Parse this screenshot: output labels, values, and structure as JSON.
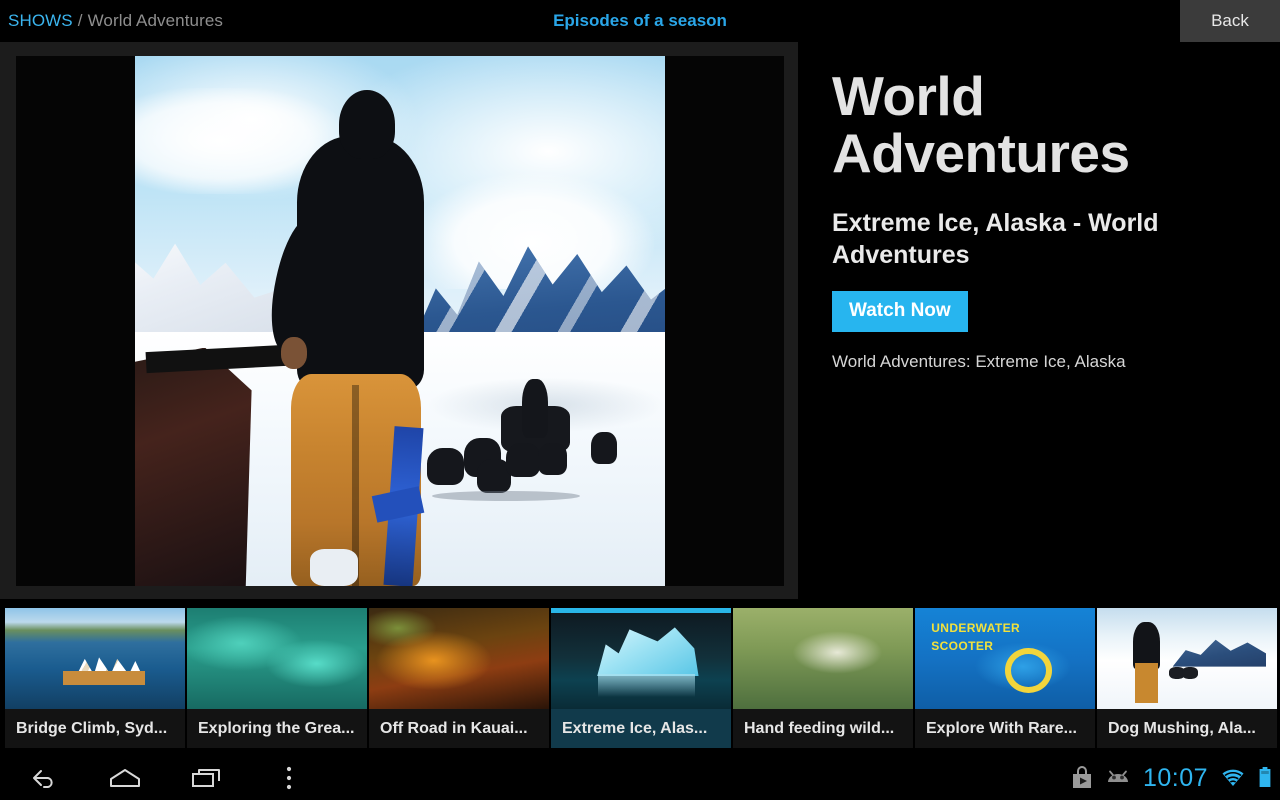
{
  "topbar": {
    "breadcrumb_root": "SHOWS",
    "breadcrumb_separator": "/",
    "breadcrumb_current": "World Adventures",
    "center_title": "Episodes of a season",
    "back_label": "Back",
    "accent_color": "#2aa6e8",
    "back_bg_color": "#3b3b3b"
  },
  "detail": {
    "show_title": "World Adventures",
    "episode_title": "Extreme Ice, Alaska - World Adventures",
    "watch_button_label": "Watch Now",
    "watch_button_color": "#27b5ef",
    "synopsis": "World Adventures: Extreme Ice, Alaska"
  },
  "player": {
    "scene_description": "Musher in black jacket and tan pants watching a dog sled team on an Alaskan glacier",
    "letterbox_color": "#050505",
    "panel_color": "#1c1c1c"
  },
  "thumbnails": {
    "selected_index": 3,
    "selected_highlight_color": "#29b6e8",
    "selected_caption_bg": "#113a4b",
    "items": [
      {
        "label": "Bridge Climb, Syd...",
        "art": "t-sydney",
        "selected": false
      },
      {
        "label": "Exploring the Grea...",
        "art": "t-reef",
        "selected": false
      },
      {
        "label": "Off Road in Kauai...",
        "art": "t-kauai",
        "selected": false
      },
      {
        "label": "Extreme Ice, Alas...",
        "art": "t-ice",
        "selected": true
      },
      {
        "label": "Hand feeding wild...",
        "art": "t-fish",
        "selected": false
      },
      {
        "label": "Explore With Rare...",
        "art": "t-scooter",
        "selected": false,
        "overlay_line1": "UNDERWATER",
        "overlay_line2": "SCOOTER"
      },
      {
        "label": "Dog Mushing, Ala...",
        "art": "t-mushing",
        "selected": false
      }
    ]
  },
  "navbar": {
    "buttons": [
      {
        "name": "back-nav-icon",
        "label": "back"
      },
      {
        "name": "home-nav-icon",
        "label": "home"
      },
      {
        "name": "recents-nav-icon",
        "label": "recents"
      },
      {
        "name": "overflow-menu-icon",
        "label": "menu"
      }
    ],
    "status": {
      "play_store_icon": "play-store-icon",
      "android_icon": "android-head-icon",
      "clock": "10:07",
      "wifi_icon": "wifi-icon",
      "battery_icon": "battery-full-icon",
      "clock_color": "#2fb5ef"
    }
  }
}
